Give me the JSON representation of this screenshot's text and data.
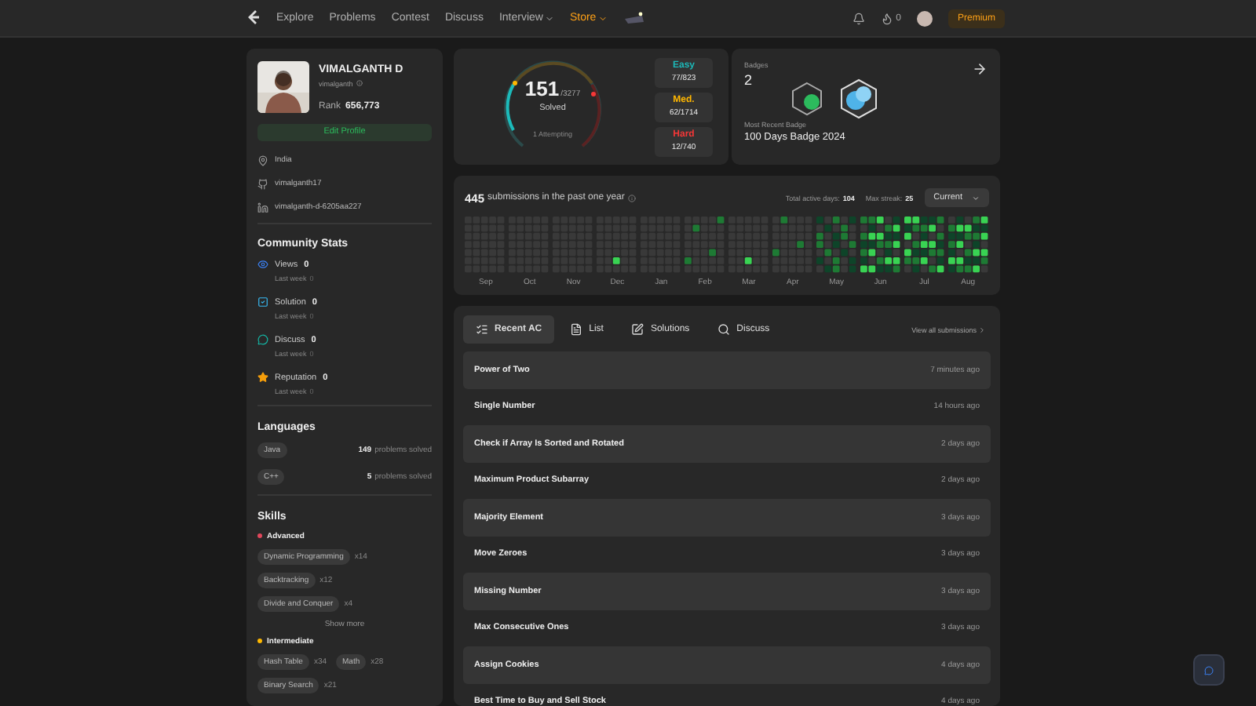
{
  "nav": {
    "links": [
      {
        "label": "Explore",
        "kind": "plain"
      },
      {
        "label": "Problems",
        "kind": "plain"
      },
      {
        "label": "Contest",
        "kind": "plain"
      },
      {
        "label": "Discuss",
        "kind": "plain"
      },
      {
        "label": "Interview",
        "kind": "menu"
      },
      {
        "label": "Store",
        "kind": "store"
      }
    ],
    "streak": "0",
    "premium": "Premium"
  },
  "profile": {
    "name": "VIMALGANTH D",
    "username": "vimalganth",
    "rank_label": "Rank",
    "rank": "656,773",
    "edit": "Edit Profile",
    "info": [
      {
        "kind": "location",
        "text": "India"
      },
      {
        "kind": "github",
        "text": "vimalganth17"
      },
      {
        "kind": "linkedin",
        "text": "vimalganth-d-6205aa227"
      }
    ]
  },
  "community": {
    "title": "Community Stats",
    "stats": [
      {
        "kind": "views",
        "label": "Views",
        "value": "0",
        "sub": "Last week",
        "sub_value": "0"
      },
      {
        "kind": "solution",
        "label": "Solution",
        "value": "0",
        "sub": "Last week",
        "sub_value": "0"
      },
      {
        "kind": "discuss",
        "label": "Discuss",
        "value": "0",
        "sub": "Last week",
        "sub_value": "0"
      },
      {
        "kind": "reputation",
        "label": "Reputation",
        "value": "0",
        "sub": "Last week",
        "sub_value": "0"
      }
    ]
  },
  "languages": {
    "title": "Languages",
    "items": [
      {
        "name": "Java",
        "count": "149",
        "unit": "problems solved"
      },
      {
        "name": "C++",
        "count": "5",
        "unit": "problems solved"
      }
    ]
  },
  "skills": {
    "title": "Skills",
    "groups": [
      {
        "name": "Advanced",
        "color": "#e0475b",
        "tags": [
          {
            "name": "Dynamic Programming",
            "count": "x14"
          },
          {
            "name": "Backtracking",
            "count": "x12"
          },
          {
            "name": "Divide and Conquer",
            "count": "x4"
          }
        ],
        "more": "Show more"
      },
      {
        "name": "Intermediate",
        "color": "#ffb800",
        "tags": [
          {
            "name": "Hash Table",
            "count": "x34"
          },
          {
            "name": "Math",
            "count": "x28"
          },
          {
            "name": "Binary Search",
            "count": "x21"
          }
        ]
      }
    ]
  },
  "solved": {
    "count": "151",
    "total": "/3277",
    "label": "Solved",
    "attempting": "1 Attempting",
    "levels": [
      {
        "name": "Easy",
        "color": "#1cbaba",
        "value": "77/823"
      },
      {
        "name": "Med.",
        "color": "#ffb700",
        "value": "62/1714"
      },
      {
        "name": "Hard",
        "color": "#f63737",
        "value": "12/740"
      }
    ]
  },
  "badges": {
    "title": "Badges",
    "count": "2",
    "recent_label": "Most Recent Badge",
    "recent": "100 Days Badge 2024"
  },
  "activity": {
    "count": "445",
    "text": "submissions in the past one year",
    "active_label": "Total active days:",
    "active": "104",
    "streak_label": "Max streak:",
    "streak": "25",
    "period": "Current",
    "months": [
      "Sep",
      "Oct",
      "Nov",
      "Dec",
      "Jan",
      "Feb",
      "Mar",
      "Apr",
      "May",
      "Jun",
      "Jul",
      "Aug"
    ]
  },
  "submissions": {
    "tabs": [
      {
        "label": "Recent AC",
        "kind": "recent",
        "selected": true
      },
      {
        "label": "List",
        "kind": "list",
        "selected": false
      },
      {
        "label": "Solutions",
        "kind": "solutions",
        "selected": false
      },
      {
        "label": "Discuss",
        "kind": "discuss",
        "selected": false
      }
    ],
    "view_all": "View all submissions",
    "rows": [
      {
        "title": "Power of Two",
        "time": "7 minutes ago"
      },
      {
        "title": "Single Number",
        "time": "14 hours ago"
      },
      {
        "title": "Check if Array Is Sorted and Rotated",
        "time": "2 days ago"
      },
      {
        "title": "Maximum Product Subarray",
        "time": "2 days ago"
      },
      {
        "title": "Majority Element",
        "time": "3 days ago"
      },
      {
        "title": "Move Zeroes",
        "time": "3 days ago"
      },
      {
        "title": "Missing Number",
        "time": "3 days ago"
      },
      {
        "title": "Max Consecutive Ones",
        "time": "3 days ago"
      },
      {
        "title": "Assign Cookies",
        "time": "4 days ago"
      },
      {
        "title": "Best Time to Buy and Sell Stock",
        "time": "4 days ago"
      }
    ]
  }
}
